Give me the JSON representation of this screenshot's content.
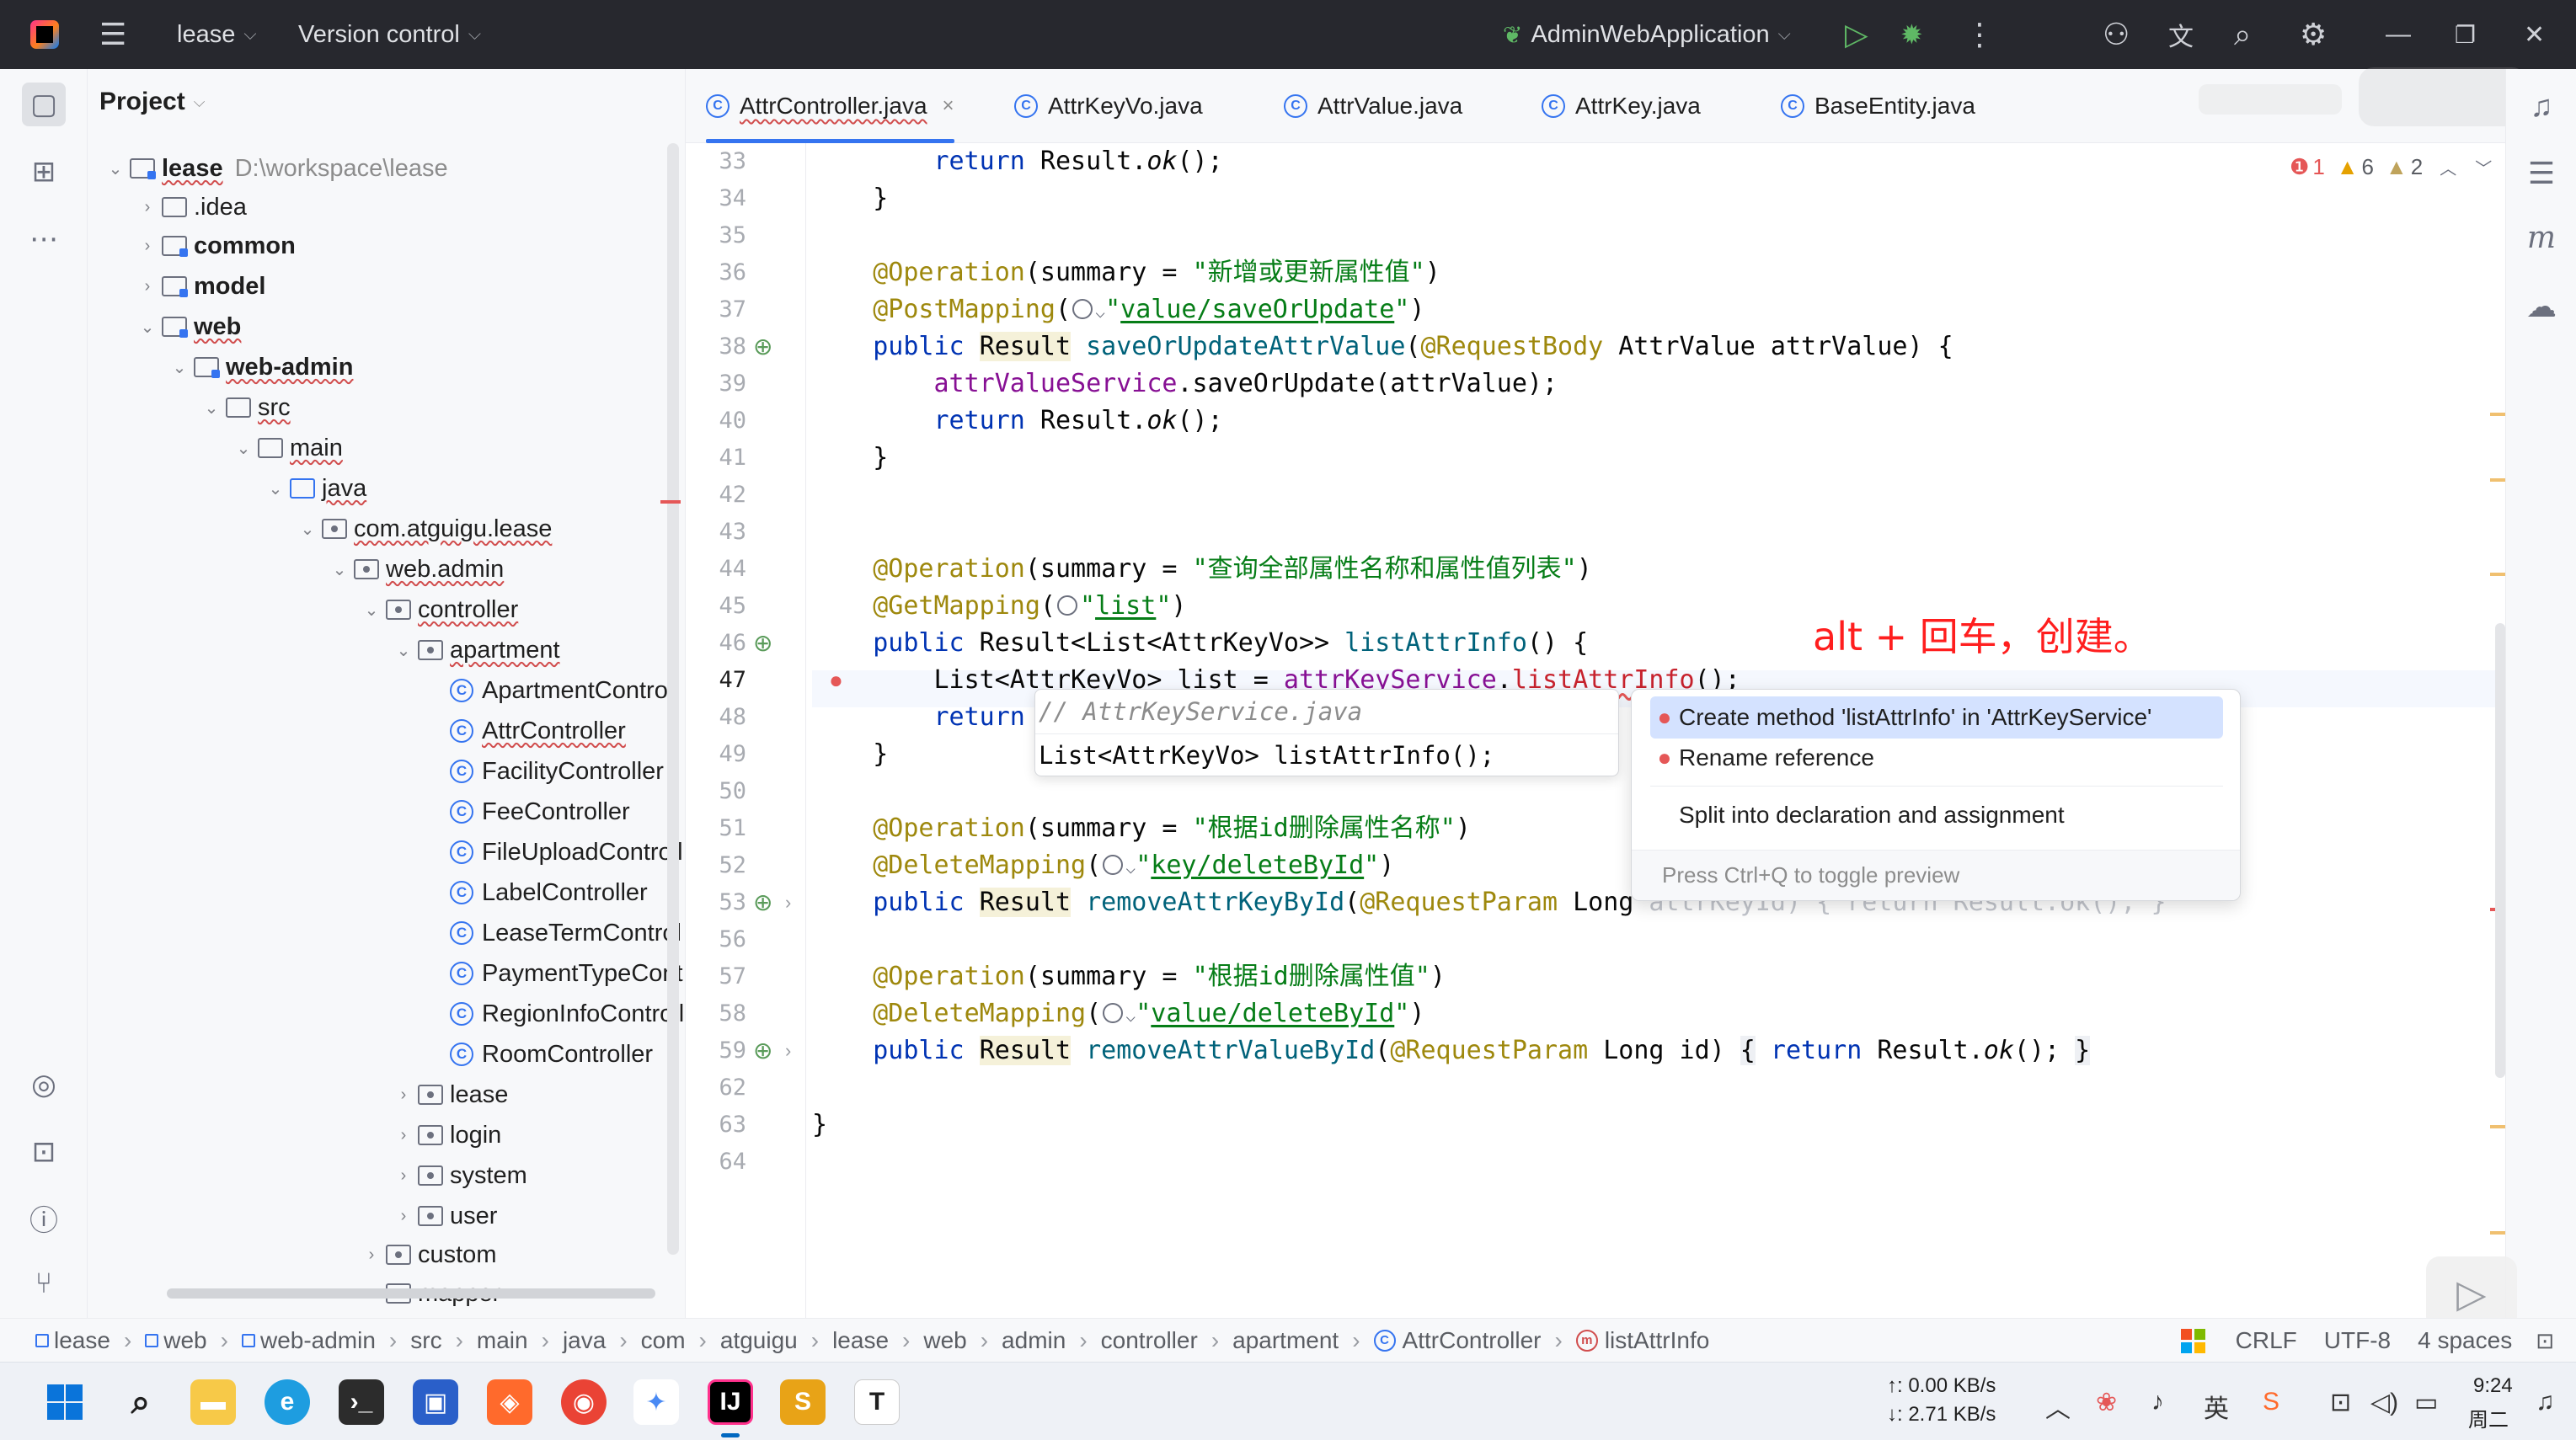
{
  "titlebar": {
    "project": "lease",
    "vcs": "Version control",
    "run_config": "AdminWebApplication"
  },
  "project_panel": {
    "title": "Project",
    "tree": [
      {
        "label": "lease",
        "path": "D:\\workspace\\lease"
      },
      {
        "label": ".idea"
      },
      {
        "label": "common"
      },
      {
        "label": "model"
      },
      {
        "label": "web"
      },
      {
        "label": "web-admin"
      },
      {
        "label": "src"
      },
      {
        "label": "main"
      },
      {
        "label": "java"
      },
      {
        "label": "com.atguigu.lease"
      },
      {
        "label": "web.admin"
      },
      {
        "label": "controller"
      },
      {
        "label": "apartment"
      },
      {
        "label": "ApartmentControll"
      },
      {
        "label": "AttrController"
      },
      {
        "label": "FacilityController"
      },
      {
        "label": "FeeController"
      },
      {
        "label": "FileUploadControll"
      },
      {
        "label": "LabelController"
      },
      {
        "label": "LeaseTermControl"
      },
      {
        "label": "PaymentTypeCont"
      },
      {
        "label": "RegionInfoControll"
      },
      {
        "label": "RoomController"
      },
      {
        "label": "lease"
      },
      {
        "label": "login"
      },
      {
        "label": "system"
      },
      {
        "label": "user"
      },
      {
        "label": "custom"
      },
      {
        "label": "mapper"
      }
    ]
  },
  "tabs": [
    {
      "label": "AttrController.java",
      "active": true
    },
    {
      "label": "AttrKeyVo.java"
    },
    {
      "label": "AttrValue.java"
    },
    {
      "label": "AttrKey.java"
    },
    {
      "label": "BaseEntity.java"
    }
  ],
  "inspections": {
    "errors": "1",
    "warnings": "6",
    "weak": "2"
  },
  "editor": {
    "line_numbers": [
      "33",
      "34",
      "35",
      "36",
      "37",
      "38",
      "39",
      "40",
      "41",
      "42",
      "43",
      "44",
      "45",
      "46",
      "47",
      "48",
      "49",
      "50",
      "51",
      "52",
      "53",
      "56",
      "57",
      "58",
      "59",
      "62",
      "63",
      "64"
    ],
    "code": {
      "l33_kw": "return",
      "l33_rest": " Result.",
      "l33_m": "ok",
      "l33_end": "();",
      "brace": "}",
      "ann_op": "@Operation",
      "ann_summary": "(summary = ",
      "s36": "\"新增或更新属性值\"",
      "close_paren": ")",
      "ann_post": "@PostMapping",
      "s37": "value/saveOrUpdate",
      "public": "public",
      "Result": "Result",
      "l38_m": "saveOrUpdateAttrValue",
      "ann_reqbody": "@RequestBody",
      "l38_rest": " AttrValue attrValue) {",
      "l39_field": "attrValueService",
      "l39_rest": ".saveOrUpdate(attrValue);",
      "s44": "\"查询全部属性名称和属性值列表\"",
      "ann_get": "@GetMapping",
      "s45": "list",
      "l46_type": " Result<List<AttrKeyVo>> ",
      "l46_m": "listAttrInfo",
      "l46_end": "() {",
      "l47_a": "List<AttrKeyVo> list = ",
      "l47_field": "attrKeyService",
      "l47_dot": ".",
      "l47_m": "listAttrInfo",
      "l47_end": "();",
      "l48_kw": "return",
      "s51": "\"根据id删除属性名称\"",
      "ann_del": "@DeleteMapping",
      "s52": "key/deleteById",
      "l53_m": "removeAttrKeyById",
      "ann_reqparam": "@RequestParam",
      "l53_rest": " Long ",
      "l53_muted": "attrKeyId) { return Result.ok(); }",
      "s57": "\"根据id删除属性值\"",
      "s58": "value/deleteById",
      "l59_m": "removeAttrValueById",
      "l59_rest": " Long id) ",
      "l59_box1": "{",
      "l59_ret": " return",
      "l59_res": " Result.",
      "l59_ok": "ok",
      "l59_end": "(); ",
      "l59_box2": "}",
      "l63": "}"
    }
  },
  "annotation_text": "alt + 回车，创建。",
  "preview_popup": {
    "comment": "// AttrKeyService.java",
    "signature": "List<AttrKeyVo> listAttrInfo();"
  },
  "intention_popup": {
    "items": [
      {
        "label": "Create method 'listAttrInfo' in 'AttrKeyService'",
        "selected": true
      },
      {
        "label": "Rename reference"
      },
      {
        "label": "Split into declaration and assignment"
      }
    ],
    "footer": "Press Ctrl+Q to toggle preview"
  },
  "statusbar": {
    "breadcrumbs": [
      "lease",
      "web",
      "web-admin",
      "src",
      "main",
      "java",
      "com",
      "atguigu",
      "lease",
      "web",
      "admin",
      "controller",
      "apartment",
      "AttrController",
      "listAttrInfo"
    ],
    "line_sep": "CRLF",
    "encoding": "UTF-8",
    "indent": "4 spaces"
  },
  "taskbar": {
    "net_up": "↑: 0.00 KB/s",
    "net_down": "↓: 2.71 KB/s",
    "time": "9:24",
    "day": "周二"
  },
  "colors": {
    "accent": "#3574f0",
    "error": "#e55757",
    "annotation_red": "#ff1e1e",
    "titlebar_bg": "#27282e"
  }
}
